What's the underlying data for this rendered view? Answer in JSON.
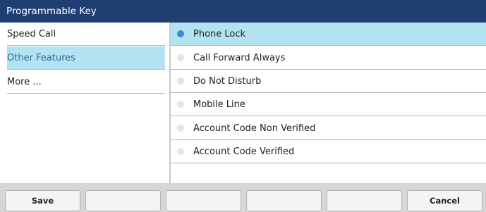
{
  "header": {
    "title": "Programmable Key"
  },
  "sidebar": {
    "items": [
      {
        "label": "Speed Call",
        "selected": false
      },
      {
        "label": "Other Features",
        "selected": true
      },
      {
        "label": "More ...",
        "selected": false
      }
    ]
  },
  "options": {
    "items": [
      {
        "label": "Phone Lock",
        "selected": true
      },
      {
        "label": "Call Forward Always",
        "selected": false
      },
      {
        "label": "Do Not Disturb",
        "selected": false
      },
      {
        "label": "Mobile Line",
        "selected": false
      },
      {
        "label": "Account Code Non Verified",
        "selected": false
      },
      {
        "label": "Account Code Verified",
        "selected": false
      }
    ]
  },
  "softkeys": {
    "keys": [
      "Save",
      "",
      "",
      "",
      "",
      "Cancel"
    ]
  },
  "colors": {
    "title_bar": "#1f3f73",
    "selection": "#b3e3f3",
    "selected_text": "#2a6e95",
    "radio_on": "#2e8fd6",
    "bottom_bar": "#d6d6d6"
  }
}
